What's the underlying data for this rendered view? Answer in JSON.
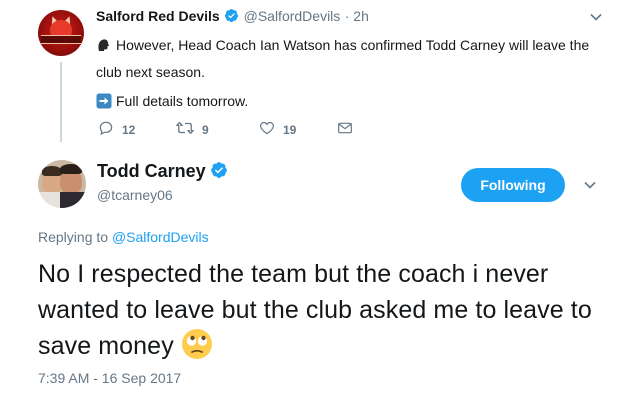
{
  "tweet1": {
    "name": "Salford Red Devils",
    "handle": "@SalfordDevils",
    "time": "· 2h",
    "line1": "However, Head Coach Ian Watson has confirmed Todd Carney will leave the club next season.",
    "line2": "Full details tomorrow.",
    "reply_count": "12",
    "retweet_count": "9",
    "like_count": "19"
  },
  "tweet2": {
    "name": "Todd Carney",
    "handle": "@tcarney06",
    "follow_label": "Following",
    "replying_prefix": "Replying to ",
    "replying_to": "@SalfordDevils",
    "text": "No I respected the team but the coach i never wanted to leave but the club asked me to leave to save money",
    "timestamp": "7:39 AM - 16 Sep 2017"
  },
  "colors": {
    "accent": "#1da1f2",
    "muted": "#657786",
    "text": "#14171a",
    "thread_line": "#ccd6dd"
  },
  "icons": {
    "speaking_head": "speaking-head-icon",
    "right_arrow": "right-arrow-icon",
    "reply": "reply-icon",
    "retweet": "retweet-icon",
    "like": "heart-icon",
    "dm": "envelope-icon",
    "verified": "verified-badge-icon",
    "more": "chevron-down-icon",
    "eye_roll": "face-with-rolling-eyes-icon"
  }
}
